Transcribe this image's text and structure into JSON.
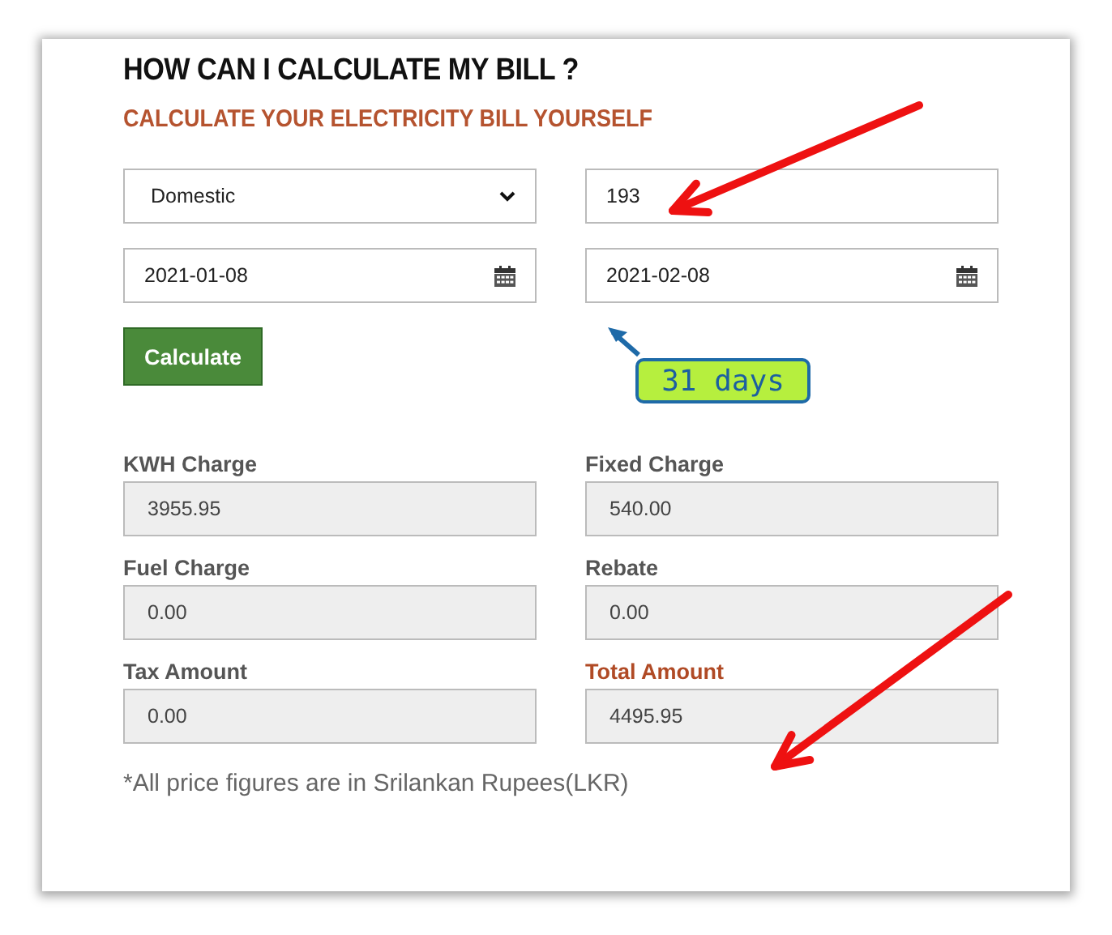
{
  "heading": "HOW CAN I CALCULATE MY BILL ?",
  "subheading": "CALCULATE YOUR ELECTRICITY BILL YOURSELF",
  "inputs": [
    {
      "kind": "select",
      "value": "Domestic"
    },
    {
      "kind": "text",
      "value": "193"
    },
    {
      "kind": "date",
      "value": "2021-01-08"
    },
    {
      "kind": "date",
      "value": "2021-02-08"
    }
  ],
  "button": "Calculate",
  "outputs": [
    {
      "label": "KWH Charge",
      "value": "3955.95",
      "highlighted": false
    },
    {
      "label": "Fixed Charge",
      "value": "540.00",
      "highlighted": false
    },
    {
      "label": "Fuel Charge",
      "value": "0.00",
      "highlighted": false
    },
    {
      "label": "Rebate",
      "value": "0.00",
      "highlighted": false
    },
    {
      "label": "Tax Amount",
      "value": "0.00",
      "highlighted": false
    },
    {
      "label": "Total Amount",
      "value": "4495.95",
      "highlighted": true
    }
  ],
  "footnote": "*All price figures are in Srilankan Rupees(LKR)",
  "arrows": [
    {
      "color": "#ee1111"
    },
    {
      "color": "#ee1111"
    }
  ],
  "callout": {
    "text": "31 days"
  }
}
